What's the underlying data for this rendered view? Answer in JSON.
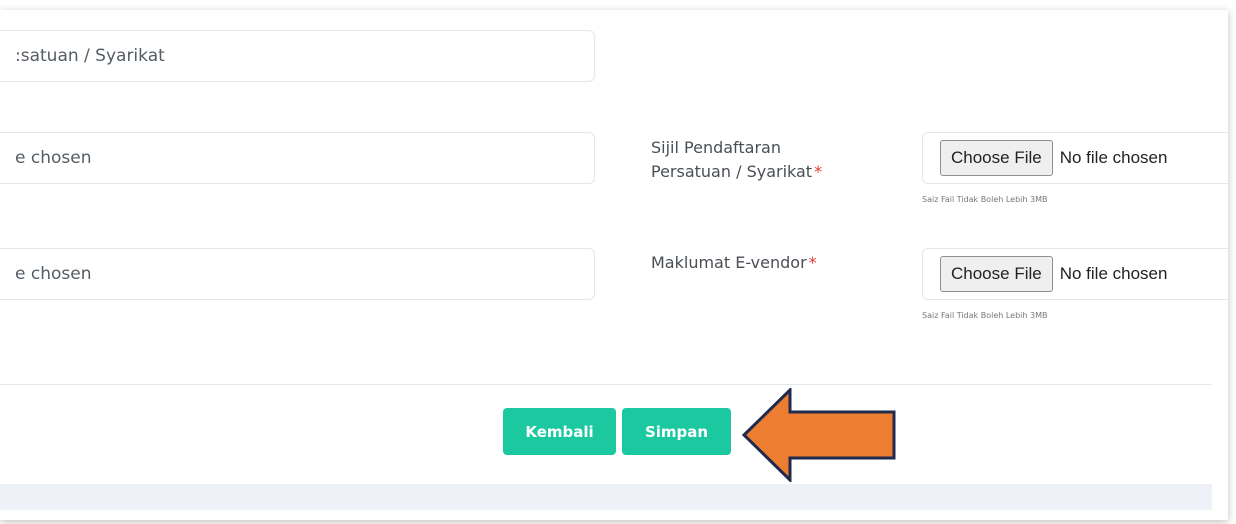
{
  "form": {
    "field_top_value": ":satuan / Syarikat",
    "field_row2_value": "e chosen",
    "field_row3_value": "e chosen",
    "sijil": {
      "label_line1": "Sijil Pendaftaran",
      "label_line2": "Persatuan / Syarikat",
      "required_mark": "*",
      "choose_label": "Choose File",
      "status": "No file chosen",
      "hint": "Saiz Fail Tidak Boleh Lebih 3MB"
    },
    "evendor": {
      "label": "Maklumat E-vendor",
      "required_mark": "*",
      "choose_label": "Choose File",
      "status": "No file chosen",
      "hint": "Saiz Fail Tidak Boleh Lebih 3MB"
    }
  },
  "actions": {
    "back_label": "Kembali",
    "save_label": "Simpan"
  },
  "annotation": {
    "arrow_color": "#ED7D31",
    "arrow_outline_color": "#1F2A4D",
    "arrow_icon": "left-arrow-icon"
  },
  "colors": {
    "button_bg": "#1CC8A0",
    "required": "#E53935"
  }
}
